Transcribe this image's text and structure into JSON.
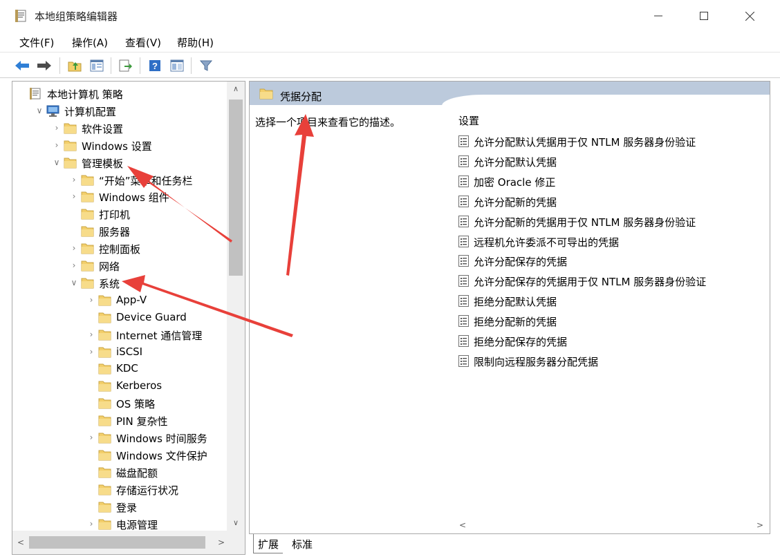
{
  "window": {
    "title": "本地组策略编辑器",
    "app_icon": "policy-editor-icon",
    "controls": [
      "minimize-icon",
      "maximize-icon",
      "close-icon"
    ]
  },
  "menu": [
    "文件(F)",
    "操作(A)",
    "查看(V)",
    "帮助(H)"
  ],
  "toolbar": {
    "buttons": [
      "back-arrow-icon",
      "forward-arrow-icon",
      "up-folder-icon",
      "show-hide-tree-icon",
      "export-list-icon",
      "help-icon",
      "extended-view-icon",
      "filter-icon"
    ]
  },
  "tree": {
    "items": [
      {
        "label": "本地计算机 策略",
        "expander": "",
        "icon": "policy-icon"
      },
      {
        "label": "计算机配置",
        "expander": "∨",
        "icon": "computer-icon"
      },
      {
        "label": "软件设置",
        "expander": "›",
        "icon": "folder-icon"
      },
      {
        "label": "Windows 设置",
        "expander": "›",
        "icon": "folder-icon"
      },
      {
        "label": "管理模板",
        "expander": "∨",
        "icon": "folder-icon"
      },
      {
        "label": "“开始”菜单和任务栏",
        "expander": "›",
        "icon": "folder-icon"
      },
      {
        "label": "Windows 组件",
        "expander": "›",
        "icon": "folder-icon"
      },
      {
        "label": "打印机",
        "expander": "",
        "icon": "folder-icon"
      },
      {
        "label": "服务器",
        "expander": "",
        "icon": "folder-icon"
      },
      {
        "label": "控制面板",
        "expander": "›",
        "icon": "folder-icon"
      },
      {
        "label": "网络",
        "expander": "›",
        "icon": "folder-icon"
      },
      {
        "label": "系统",
        "expander": "∨",
        "icon": "folder-icon"
      },
      {
        "label": "App-V",
        "expander": "›",
        "icon": "folder-icon"
      },
      {
        "label": "Device Guard",
        "expander": "",
        "icon": "folder-icon"
      },
      {
        "label": "Internet 通信管理",
        "expander": "›",
        "icon": "folder-icon"
      },
      {
        "label": "iSCSI",
        "expander": "›",
        "icon": "folder-icon"
      },
      {
        "label": "KDC",
        "expander": "",
        "icon": "folder-icon"
      },
      {
        "label": "Kerberos",
        "expander": "",
        "icon": "folder-icon"
      },
      {
        "label": "OS 策略",
        "expander": "",
        "icon": "folder-icon"
      },
      {
        "label": "PIN 复杂性",
        "expander": "",
        "icon": "folder-icon"
      },
      {
        "label": "Windows 时间服务",
        "expander": "›",
        "icon": "folder-icon"
      },
      {
        "label": "Windows 文件保护",
        "expander": "",
        "icon": "folder-icon"
      },
      {
        "label": "磁盘配额",
        "expander": "",
        "icon": "folder-icon"
      },
      {
        "label": "存储运行状况",
        "expander": "",
        "icon": "folder-icon"
      },
      {
        "label": "登录",
        "expander": "",
        "icon": "folder-icon"
      },
      {
        "label": "电源管理",
        "expander": "›",
        "icon": "folder-icon"
      }
    ],
    "scroll_up": "∧",
    "scroll_down": "∨",
    "scroll_left": "<",
    "scroll_right": ">"
  },
  "details": {
    "folder_title": "凭据分配",
    "description": "选择一个项目来查看它的描述。",
    "column_header": "设置",
    "settings": [
      "允许分配默认凭据用于仅 NTLM 服务器身份验证",
      "允许分配默认凭据",
      "加密 Oracle 修正",
      "允许分配新的凭据",
      "允许分配新的凭据用于仅 NTLM 服务器身份验证",
      "远程机允许委派不可导出的凭据",
      "允许分配保存的凭据",
      "允许分配保存的凭据用于仅 NTLM 服务器身份验证",
      "拒绝分配默认凭据",
      "拒绝分配新的凭据",
      "拒绝分配保存的凭据",
      "限制向远程服务器分配凭据"
    ],
    "scroll_left": "<",
    "scroll_right": ">"
  },
  "tabs": [
    "扩展",
    "标准"
  ],
  "colors": {
    "annotation_arrow": "#e8403a",
    "folder": "#f3cf6b",
    "header_band": "#bccadc"
  }
}
